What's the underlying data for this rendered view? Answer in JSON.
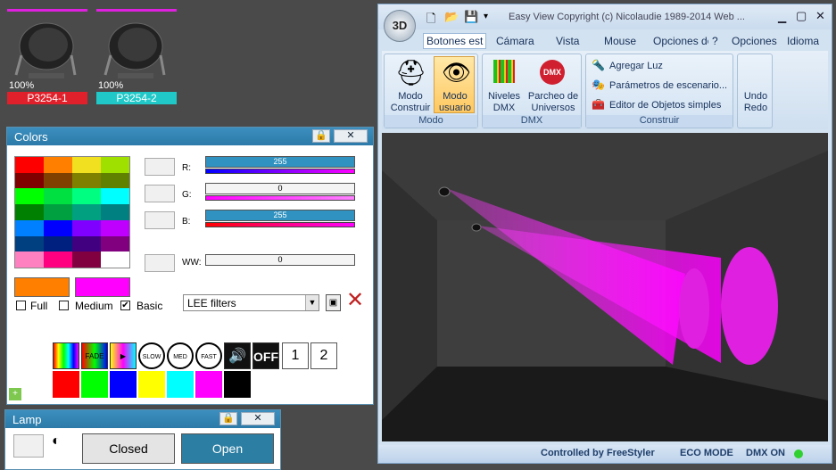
{
  "fixtures": [
    {
      "percent": "100%",
      "name": "P3254-1",
      "color": "#e0202a"
    },
    {
      "percent": "100%",
      "name": "P3254-2",
      "color": "#20c8c8"
    }
  ],
  "colors_window": {
    "title": "Colors",
    "lock_icon": "lock-icon",
    "close_label": "✕",
    "palette": [
      "#ff0000",
      "#ff8000",
      "#f0e020",
      "#a0e000",
      "#800000",
      "#804000",
      "#808000",
      "#608000",
      "#00ff00",
      "#00e040",
      "#00ff80",
      "#00ffff",
      "#008000",
      "#00a040",
      "#00a080",
      "#008080",
      "#0080ff",
      "#0000ff",
      "#8000ff",
      "#c000ff",
      "#004080",
      "#002080",
      "#400080",
      "#800080",
      "#ff80c0",
      "#ff0080",
      "#800040",
      "#ffffff"
    ],
    "labels": {
      "r": "R:",
      "g": "G:",
      "b": "B:",
      "ww": "WW:"
    },
    "values": {
      "r": "255",
      "g": "0",
      "b": "255",
      "ww": "0"
    },
    "swatch_a": "#ff8000",
    "swatch_b": "#ff00ff",
    "options": {
      "full": "Full",
      "medium": "Medium",
      "basic": "Basic",
      "basic_checked": "✔"
    },
    "filter_select": "LEE filters",
    "effects": [
      "FADE",
      "SLOW",
      "MED",
      "FAST",
      "OFF"
    ],
    "buttons": {
      "one": "1",
      "two": "2"
    },
    "quick_colors": [
      "#ff0000",
      "#00ff00",
      "#0000ff",
      "#ffff00",
      "#00ffff",
      "#ff00ff",
      "#000000"
    ]
  },
  "lamp_window": {
    "title": "Lamp",
    "close_label": "✕",
    "closed": "Closed",
    "open": "Open"
  },
  "app": {
    "title": "Easy View  Copyright (c) Nicolaudie 1989-2014  Web ...",
    "logo": "3D",
    "tabs": [
      "Botones est",
      "Cámara",
      "Vista",
      "Mouse",
      "Opciones de",
      "?",
      "Opciones",
      "Idioma"
    ],
    "groups": {
      "modo": "Modo",
      "dmx": "DMX",
      "construir": "Construir"
    },
    "buttons": {
      "modo_construir": "Modo\nConstruir",
      "modo_usuario": "Modo\nusuario",
      "niveles": "Niveles\nDMX",
      "parcheo": "Parcheo de\nUniversos",
      "agregar": "Agregar Luz",
      "parametros": "Parámetros de escenario...",
      "editor": "Editor de Objetos simples",
      "undo": "Undo\nRedo"
    },
    "status": {
      "controlled": "Controlled by FreeStyler",
      "eco": "ECO MODE",
      "dmx": "DMX ON"
    }
  }
}
